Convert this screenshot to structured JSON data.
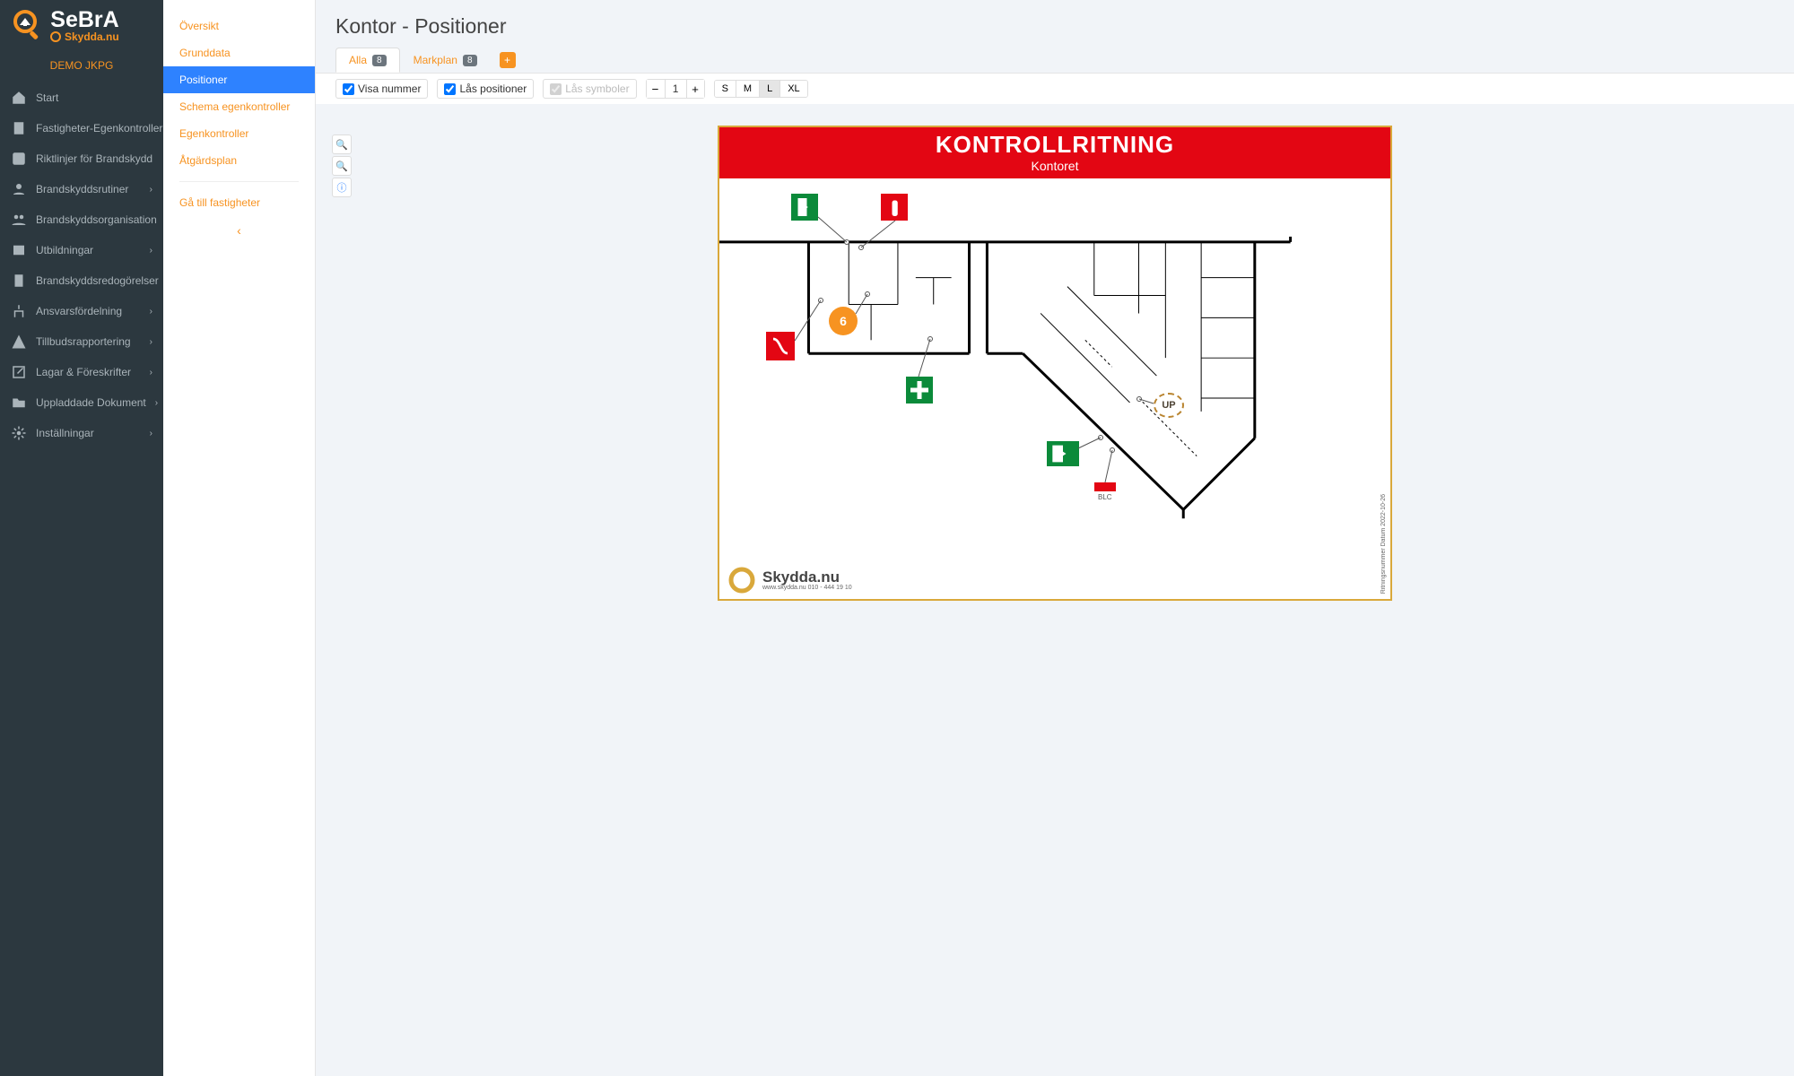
{
  "brand": {
    "name": "SeBrA",
    "tagline": "Skydda.nu",
    "demo_label": "DEMO JKPG"
  },
  "nav": [
    {
      "label": "Start",
      "chev": false
    },
    {
      "label": "Fastigheter-Egenkontroller",
      "chev": false
    },
    {
      "label": "Riktlinjer för Brandskydd",
      "chev": false
    },
    {
      "label": "Brandskyddsrutiner",
      "chev": true
    },
    {
      "label": "Brandskyddsorganisation",
      "chev": true
    },
    {
      "label": "Utbildningar",
      "chev": true
    },
    {
      "label": "Brandskyddsredogörelser",
      "chev": true
    },
    {
      "label": "Ansvarsfördelning",
      "chev": true
    },
    {
      "label": "Tillbudsrapportering",
      "chev": true
    },
    {
      "label": "Lagar & Föreskrifter",
      "chev": true
    },
    {
      "label": "Uppladdade Dokument",
      "chev": true
    },
    {
      "label": "Inställningar",
      "chev": true
    }
  ],
  "subnav": {
    "items": [
      {
        "label": "Översikt",
        "active": false
      },
      {
        "label": "Grunddata",
        "active": false
      },
      {
        "label": "Positioner",
        "active": true
      },
      {
        "label": "Schema egenkontroller",
        "active": false
      },
      {
        "label": "Egenkontroller",
        "active": false
      },
      {
        "label": "Åtgärdsplan",
        "active": false
      }
    ],
    "back_label": "Gå till fastigheter"
  },
  "page": {
    "title": "Kontor - Positioner"
  },
  "tabs": [
    {
      "label": "Alla",
      "badge": "8",
      "selected": true
    },
    {
      "label": "Markplan",
      "badge": "8",
      "selected": false
    }
  ],
  "toolbar": {
    "show_number": {
      "label": "Visa nummer",
      "checked": true
    },
    "lock_positions": {
      "label": "Lås positioner",
      "checked": true
    },
    "lock_symbols": {
      "label": "Lås symboler",
      "checked": true,
      "disabled": true
    },
    "step_value": "1",
    "sizes": [
      "S",
      "M",
      "L",
      "XL"
    ],
    "size_selected": "L"
  },
  "drawing": {
    "title": "KONTROLLRITNING",
    "subtitle": "Kontoret",
    "marker6": "6",
    "up_label": "UP",
    "blc": "BLC",
    "footer_brand": "Skydda.nu",
    "footer_sub": "www.skydda.nu   010 - 444 19 10",
    "side_text": "Ritningsnummer    Datum  2022-10-26"
  }
}
